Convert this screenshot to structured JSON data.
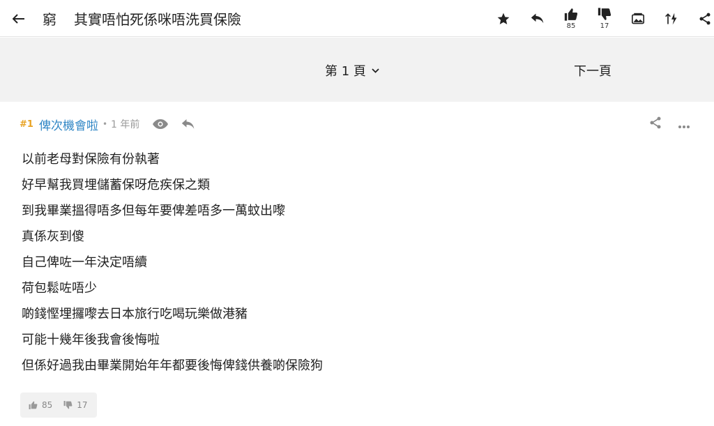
{
  "topbar": {
    "back_icon": "back-arrow-icon",
    "channel": "窮",
    "title": "其實唔怕死係咪唔洗買保險",
    "likes": "85",
    "dislikes": "17",
    "icons": [
      "star-icon",
      "reply-icon",
      "thumbs-up-icon",
      "thumbs-down-icon",
      "image-toggle-icon",
      "sort-icon",
      "share-icon"
    ]
  },
  "pager": {
    "current_page": "第 1 頁",
    "next_label": "下一頁"
  },
  "post": {
    "number": "#1",
    "author": "俾次機會啦",
    "separator": "•",
    "time": "1 年前",
    "lines": [
      "以前老母對保險有份執著",
      "好早幫我買埋儲蓄保呀危疾保之類",
      "到我畢業搵得唔多但每年要俾差唔多一萬蚊出嚟",
      "真係灰到傻",
      "自己俾咗一年決定唔續",
      "荷包鬆咗唔少",
      "啲錢慳埋攞嚟去日本旅行吃喝玩樂做港豬",
      "可能十幾年後我會後悔啦",
      "但係好過我由畢業開始年年都要後悔俾錢供養啲保險狗"
    ],
    "likes": "85",
    "dislikes": "17"
  },
  "colors": {
    "author": "#2f86c5",
    "post_number": "#e8a325",
    "pager_bg": "#f2f2f2"
  }
}
